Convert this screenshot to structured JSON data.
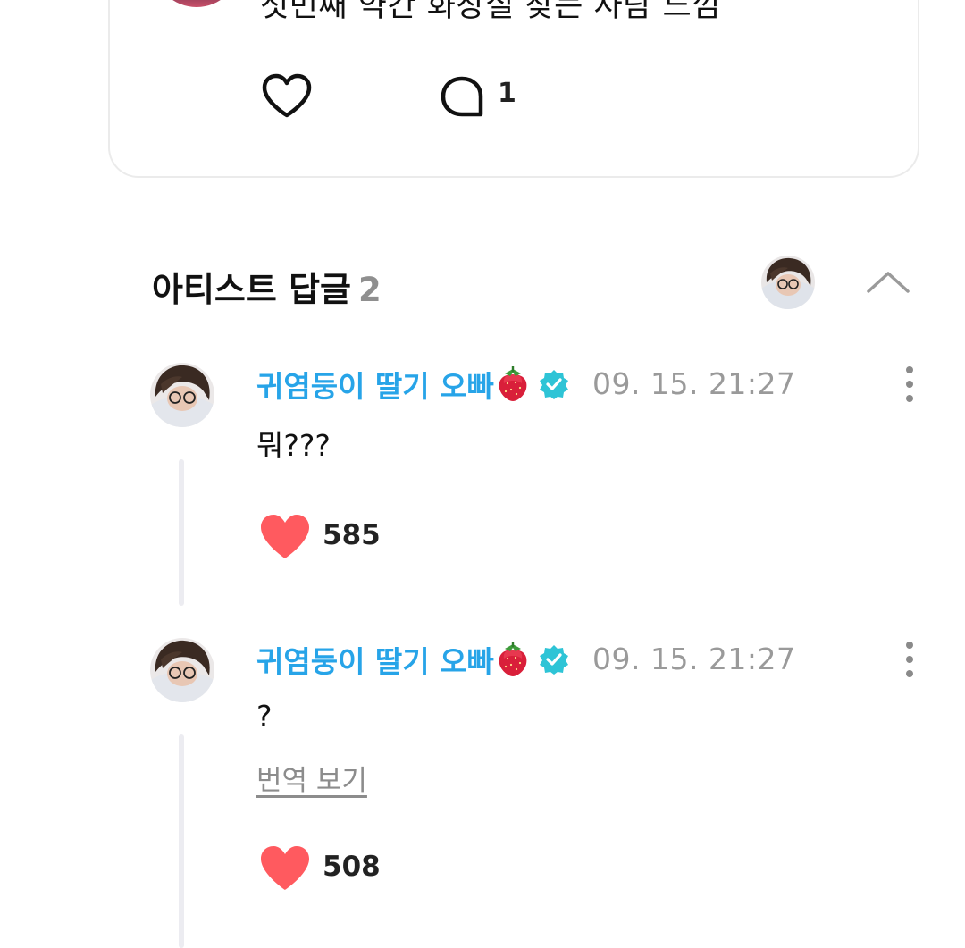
{
  "post": {
    "text": "첫번째 약간 화장실 찾는 사람 느낌",
    "comment_count": "1",
    "icons": {
      "like": "heart-outline-icon",
      "comment": "speech-bubble-icon"
    }
  },
  "artist_replies": {
    "title": "아티스트 답글",
    "count": "2",
    "icons": {
      "collapse": "chevron-up-icon"
    }
  },
  "comments": [
    {
      "author": "귀염둥이 딸기 오빠",
      "author_emoji": "strawberry-icon",
      "verified": true,
      "timestamp": "09. 15. 21:27",
      "body": "뭐???",
      "likes": "585"
    },
    {
      "author": "귀염둥이 딸기 오빠",
      "author_emoji": "strawberry-icon",
      "verified": true,
      "timestamp": "09. 15. 21:27",
      "body": "?",
      "translate_label": "번역 보기",
      "likes": "508"
    }
  ],
  "colors": {
    "author_name": "#27a4e8",
    "verified_badge": "#2ec4d6",
    "like_heart": "#ff5a5f",
    "count_muted": "#8f8f8f",
    "timestamp": "#9a9a9a",
    "thread_line": "#ececf1"
  }
}
